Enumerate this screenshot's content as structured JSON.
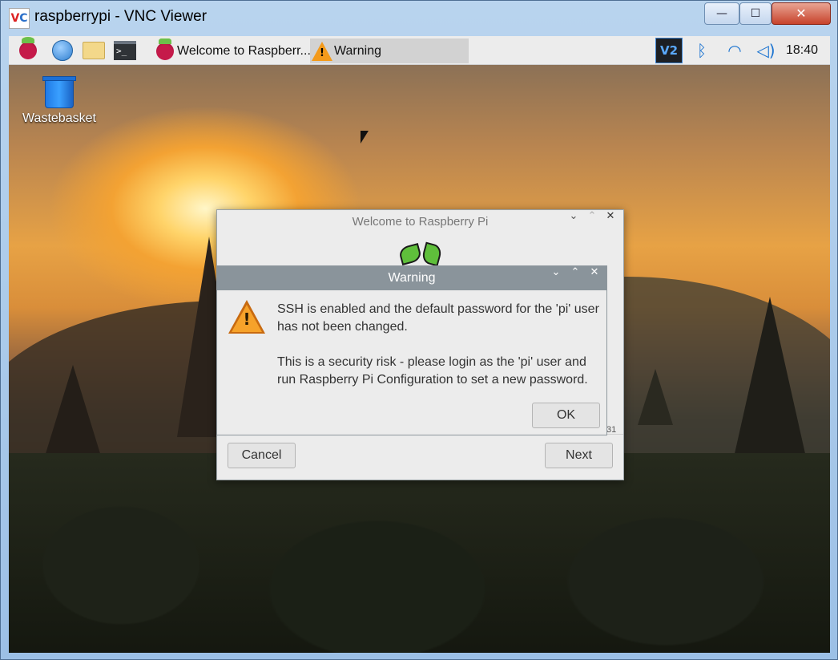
{
  "window": {
    "title": "raspberrypi - VNC Viewer",
    "logo_text_v": "V",
    "logo_text_c": "C",
    "controls": {
      "minimize": "—",
      "maximize": "☐",
      "close": "✕"
    }
  },
  "taskbar": {
    "launchers": [
      "raspberry-menu",
      "web-browser",
      "file-manager",
      "terminal"
    ],
    "terminal_glyph": ">_",
    "tasks": [
      {
        "label": "Welcome to Raspberr...",
        "active": false
      },
      {
        "label": "Warning",
        "active": true
      }
    ],
    "tray": {
      "vnc": "V2",
      "bluetooth": "ᛒ",
      "wifi": "◠",
      "volume": "◁)"
    },
    "clock": "18:40"
  },
  "desktop": {
    "icons": [
      {
        "label": "Wastebasket",
        "icon": "trash-icon"
      }
    ]
  },
  "welcome_dialog": {
    "title": "Welcome to Raspberry Pi",
    "partial_text": "31",
    "cancel_label": "Cancel",
    "next_label": "Next",
    "controls": {
      "minimize": "⌄",
      "maximize": "⌃",
      "close": "✕"
    }
  },
  "warning_dialog": {
    "title": "Warning",
    "message_line1": "SSH is enabled and the default password for the 'pi' user has not been changed.",
    "message_line2": "This is a security risk - please login as the 'pi' user and run Raspberry Pi Configuration to set a new password.",
    "ok_label": "OK",
    "controls": {
      "minimize": "⌄",
      "maximize": "⌃",
      "close": "✕"
    }
  },
  "colors": {
    "warning_titlebar": "#8a949b",
    "warning_icon": "#f6a22a",
    "taskbar": "#ececec",
    "vnc_accent": "#3f88d8"
  }
}
